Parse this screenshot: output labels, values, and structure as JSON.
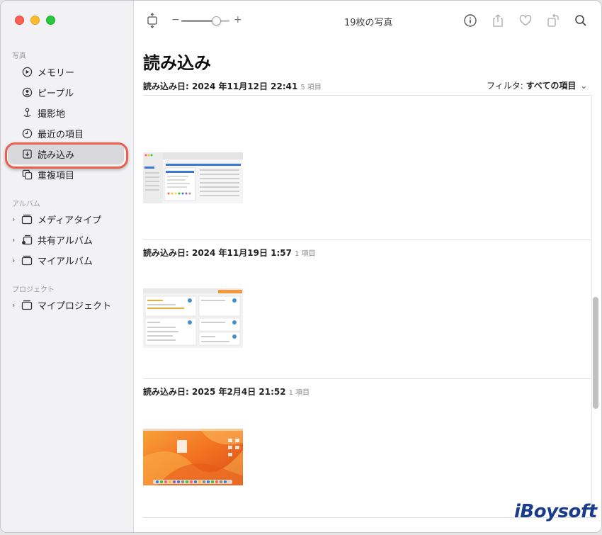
{
  "sidebar": {
    "sections": {
      "photos": "写真",
      "albums": "アルバム",
      "projects": "プロジェクト"
    },
    "items": [
      {
        "label": "メモリー",
        "icon": "memories-icon"
      },
      {
        "label": "ピープル",
        "icon": "people-icon"
      },
      {
        "label": "撮影地",
        "icon": "places-icon"
      },
      {
        "label": "最近の項目",
        "icon": "recents-icon"
      },
      {
        "label": "読み込み",
        "icon": "imports-icon",
        "selected": true
      },
      {
        "label": "重複項目",
        "icon": "duplicates-icon"
      }
    ],
    "albums": [
      {
        "label": "メディアタイプ"
      },
      {
        "label": "共有アルバム"
      },
      {
        "label": "マイアルバム"
      }
    ],
    "projects": [
      {
        "label": "マイプロジェクト"
      }
    ]
  },
  "toolbar": {
    "title": "19枚の写真",
    "slider_minus": "−",
    "slider_plus": "+",
    "zoom_level": 0.72
  },
  "main": {
    "title": "読み込み",
    "filter_label": "フィルタ:",
    "filter_value": "すべての項目",
    "imports": [
      {
        "header": "読み込み日: 2024 年11月12日 22:41",
        "count": "5 項目"
      },
      {
        "header": "読み込み日: 2024 年11月19日 1:57",
        "count": "1 項目"
      },
      {
        "header": "読み込み日: 2025 年2月4日 21:52",
        "count": "1 項目"
      }
    ]
  },
  "watermark": "iBoysoft",
  "colors": {
    "accent_ring": "#e9604f",
    "sidebar_bg": "#f2f2f4",
    "watermark": "#1a3a8a"
  }
}
